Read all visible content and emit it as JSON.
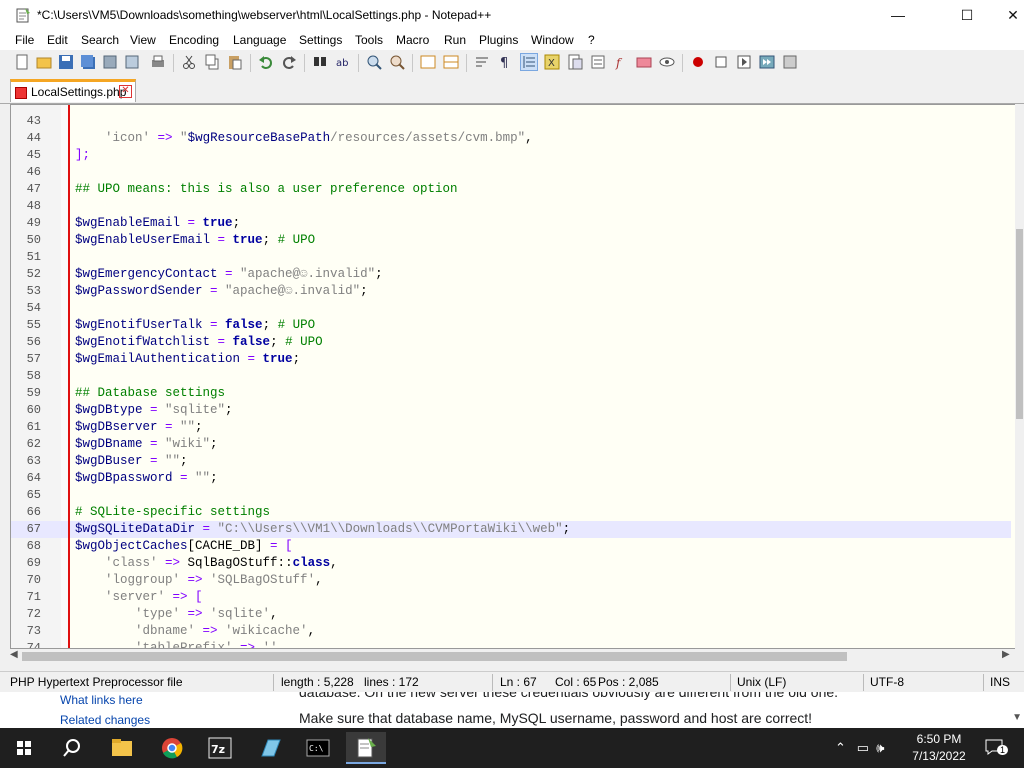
{
  "window": {
    "title": "*C:\\Users\\VM5\\Downloads\\something\\webserver\\html\\LocalSettings.php - Notepad++"
  },
  "menu": [
    "File",
    "Edit",
    "Search",
    "View",
    "Encoding",
    "Language",
    "Settings",
    "Tools",
    "Macro",
    "Run",
    "Plugins",
    "Window",
    "?"
  ],
  "tab": {
    "label": "LocalSettings.php"
  },
  "editor": {
    "current_line": 67,
    "lines": [
      {
        "n": "43",
        "code": []
      },
      {
        "n": "44",
        "code": [
          {
            "t": "    ",
            "c": ""
          },
          {
            "t": "'icon'",
            "c": "str"
          },
          {
            "t": " => ",
            "c": "op"
          },
          {
            "t": "\"",
            "c": "str"
          },
          {
            "t": "$wgResourceBasePath",
            "c": "var"
          },
          {
            "t": "/resources/assets/cvm.bmp\"",
            "c": "str"
          },
          {
            "t": ",",
            "c": ""
          }
        ]
      },
      {
        "n": "45",
        "code": [
          {
            "t": "];",
            "c": "op"
          }
        ]
      },
      {
        "n": "46",
        "code": []
      },
      {
        "n": "47",
        "code": [
          {
            "t": "## UPO means: this is also a user preference option",
            "c": "cmt"
          }
        ]
      },
      {
        "n": "48",
        "code": []
      },
      {
        "n": "49",
        "code": [
          {
            "t": "$wgEnableEmail",
            "c": "var"
          },
          {
            "t": " = ",
            "c": "op"
          },
          {
            "t": "true",
            "c": "kw"
          },
          {
            "t": ";",
            "c": ""
          }
        ]
      },
      {
        "n": "50",
        "code": [
          {
            "t": "$wgEnableUserEmail",
            "c": "var"
          },
          {
            "t": " = ",
            "c": "op"
          },
          {
            "t": "true",
            "c": "kw"
          },
          {
            "t": "; ",
            "c": ""
          },
          {
            "t": "# UPO",
            "c": "cmt"
          }
        ]
      },
      {
        "n": "51",
        "code": []
      },
      {
        "n": "52",
        "code": [
          {
            "t": "$wgEmergencyContact",
            "c": "var"
          },
          {
            "t": " = ",
            "c": "op"
          },
          {
            "t": "\"apache@☺.invalid\"",
            "c": "str"
          },
          {
            "t": ";",
            "c": ""
          }
        ]
      },
      {
        "n": "53",
        "code": [
          {
            "t": "$wgPasswordSender",
            "c": "var"
          },
          {
            "t": " = ",
            "c": "op"
          },
          {
            "t": "\"apache@☺.invalid\"",
            "c": "str"
          },
          {
            "t": ";",
            "c": ""
          }
        ]
      },
      {
        "n": "54",
        "code": []
      },
      {
        "n": "55",
        "code": [
          {
            "t": "$wgEnotifUserTalk",
            "c": "var"
          },
          {
            "t": " = ",
            "c": "op"
          },
          {
            "t": "false",
            "c": "kw"
          },
          {
            "t": "; ",
            "c": ""
          },
          {
            "t": "# UPO",
            "c": "cmt"
          }
        ]
      },
      {
        "n": "56",
        "code": [
          {
            "t": "$wgEnotifWatchlist",
            "c": "var"
          },
          {
            "t": " = ",
            "c": "op"
          },
          {
            "t": "false",
            "c": "kw"
          },
          {
            "t": "; ",
            "c": ""
          },
          {
            "t": "# UPO",
            "c": "cmt"
          }
        ]
      },
      {
        "n": "57",
        "code": [
          {
            "t": "$wgEmailAuthentication",
            "c": "var"
          },
          {
            "t": " = ",
            "c": "op"
          },
          {
            "t": "true",
            "c": "kw"
          },
          {
            "t": ";",
            "c": ""
          }
        ]
      },
      {
        "n": "58",
        "code": []
      },
      {
        "n": "59",
        "code": [
          {
            "t": "## Database settings",
            "c": "cmt"
          }
        ]
      },
      {
        "n": "60",
        "code": [
          {
            "t": "$wgDBtype",
            "c": "var"
          },
          {
            "t": " = ",
            "c": "op"
          },
          {
            "t": "\"sqlite\"",
            "c": "str"
          },
          {
            "t": ";",
            "c": ""
          }
        ]
      },
      {
        "n": "61",
        "code": [
          {
            "t": "$wgDBserver",
            "c": "var"
          },
          {
            "t": " = ",
            "c": "op"
          },
          {
            "t": "\"\"",
            "c": "str"
          },
          {
            "t": ";",
            "c": ""
          }
        ]
      },
      {
        "n": "62",
        "code": [
          {
            "t": "$wgDBname",
            "c": "var"
          },
          {
            "t": " = ",
            "c": "op"
          },
          {
            "t": "\"wiki\"",
            "c": "str"
          },
          {
            "t": ";",
            "c": ""
          }
        ]
      },
      {
        "n": "63",
        "code": [
          {
            "t": "$wgDBuser",
            "c": "var"
          },
          {
            "t": " = ",
            "c": "op"
          },
          {
            "t": "\"\"",
            "c": "str"
          },
          {
            "t": ";",
            "c": ""
          }
        ]
      },
      {
        "n": "64",
        "code": [
          {
            "t": "$wgDBpassword",
            "c": "var"
          },
          {
            "t": " = ",
            "c": "op"
          },
          {
            "t": "\"\"",
            "c": "str"
          },
          {
            "t": ";",
            "c": ""
          }
        ]
      },
      {
        "n": "65",
        "code": []
      },
      {
        "n": "66",
        "code": [
          {
            "t": "# SQLite-specific settings",
            "c": "cmt"
          }
        ]
      },
      {
        "n": "67",
        "code": [
          {
            "t": "$wgSQLiteDataDir",
            "c": "var"
          },
          {
            "t": " = ",
            "c": "op"
          },
          {
            "t": "\"C:\\\\Users\\\\VM1\\\\Downloads\\\\CVMPortaWiki\\\\web\"",
            "c": "str"
          },
          {
            "t": ";",
            "c": ""
          }
        ]
      },
      {
        "n": "68",
        "code": [
          {
            "t": "$wgObjectCaches",
            "c": "var"
          },
          {
            "t": "[CACHE_DB] ",
            "c": ""
          },
          {
            "t": "= [",
            "c": "op"
          }
        ]
      },
      {
        "n": "69",
        "code": [
          {
            "t": "    ",
            "c": ""
          },
          {
            "t": "'class'",
            "c": "str"
          },
          {
            "t": " => ",
            "c": "op"
          },
          {
            "t": "SqlBagOStuff::",
            "c": ""
          },
          {
            "t": "class",
            "c": "kw"
          },
          {
            "t": ",",
            "c": ""
          }
        ]
      },
      {
        "n": "70",
        "code": [
          {
            "t": "    ",
            "c": ""
          },
          {
            "t": "'loggroup'",
            "c": "str"
          },
          {
            "t": " => ",
            "c": "op"
          },
          {
            "t": "'SQLBagOStuff'",
            "c": "str"
          },
          {
            "t": ",",
            "c": ""
          }
        ]
      },
      {
        "n": "71",
        "code": [
          {
            "t": "    ",
            "c": ""
          },
          {
            "t": "'server'",
            "c": "str"
          },
          {
            "t": " => [",
            "c": "op"
          }
        ]
      },
      {
        "n": "72",
        "code": [
          {
            "t": "        ",
            "c": ""
          },
          {
            "t": "'type'",
            "c": "str"
          },
          {
            "t": " => ",
            "c": "op"
          },
          {
            "t": "'sqlite'",
            "c": "str"
          },
          {
            "t": ",",
            "c": ""
          }
        ]
      },
      {
        "n": "73",
        "code": [
          {
            "t": "        ",
            "c": ""
          },
          {
            "t": "'dbname'",
            "c": "str"
          },
          {
            "t": " => ",
            "c": "op"
          },
          {
            "t": "'wikicache'",
            "c": "str"
          },
          {
            "t": ",",
            "c": ""
          }
        ]
      },
      {
        "n": "74",
        "code": [
          {
            "t": "        ",
            "c": ""
          },
          {
            "t": "'tablePrefix'",
            "c": "str"
          },
          {
            "t": " => ",
            "c": "op"
          },
          {
            "t": "''",
            "c": "str"
          },
          {
            "t": ",",
            "c": ""
          }
        ]
      }
    ]
  },
  "status": {
    "filetype": "PHP Hypertext Preprocessor file",
    "length": "length : 5,228",
    "lines": "lines : 172",
    "ln": "Ln : 67",
    "col": "Col : 65",
    "pos": "Pos : 2,085",
    "eol": "Unix (LF)",
    "encoding": "UTF-8",
    "mode": "INS"
  },
  "background_page": {
    "links": [
      "What links here",
      "Related changes"
    ],
    "text1": "database. On the new server these credentials obviously are different from the old one.",
    "text2": "Make sure that database name, MySQL username, password and host are correct!"
  },
  "taskbar": {
    "time": "6:50 PM",
    "date": "7/13/2022",
    "notifications": "1",
    "apps": [
      "start-icon",
      "search-icon",
      "file-explorer-icon",
      "chrome-icon",
      "7zip-icon",
      "notepad-icon",
      "terminal-icon",
      "notepadpp-icon"
    ]
  },
  "colors": {
    "accent_tab": "#f5a623",
    "edge_line": "#e01010",
    "current_line": "#e8e8ff",
    "editor_bg": "#fffff5"
  }
}
